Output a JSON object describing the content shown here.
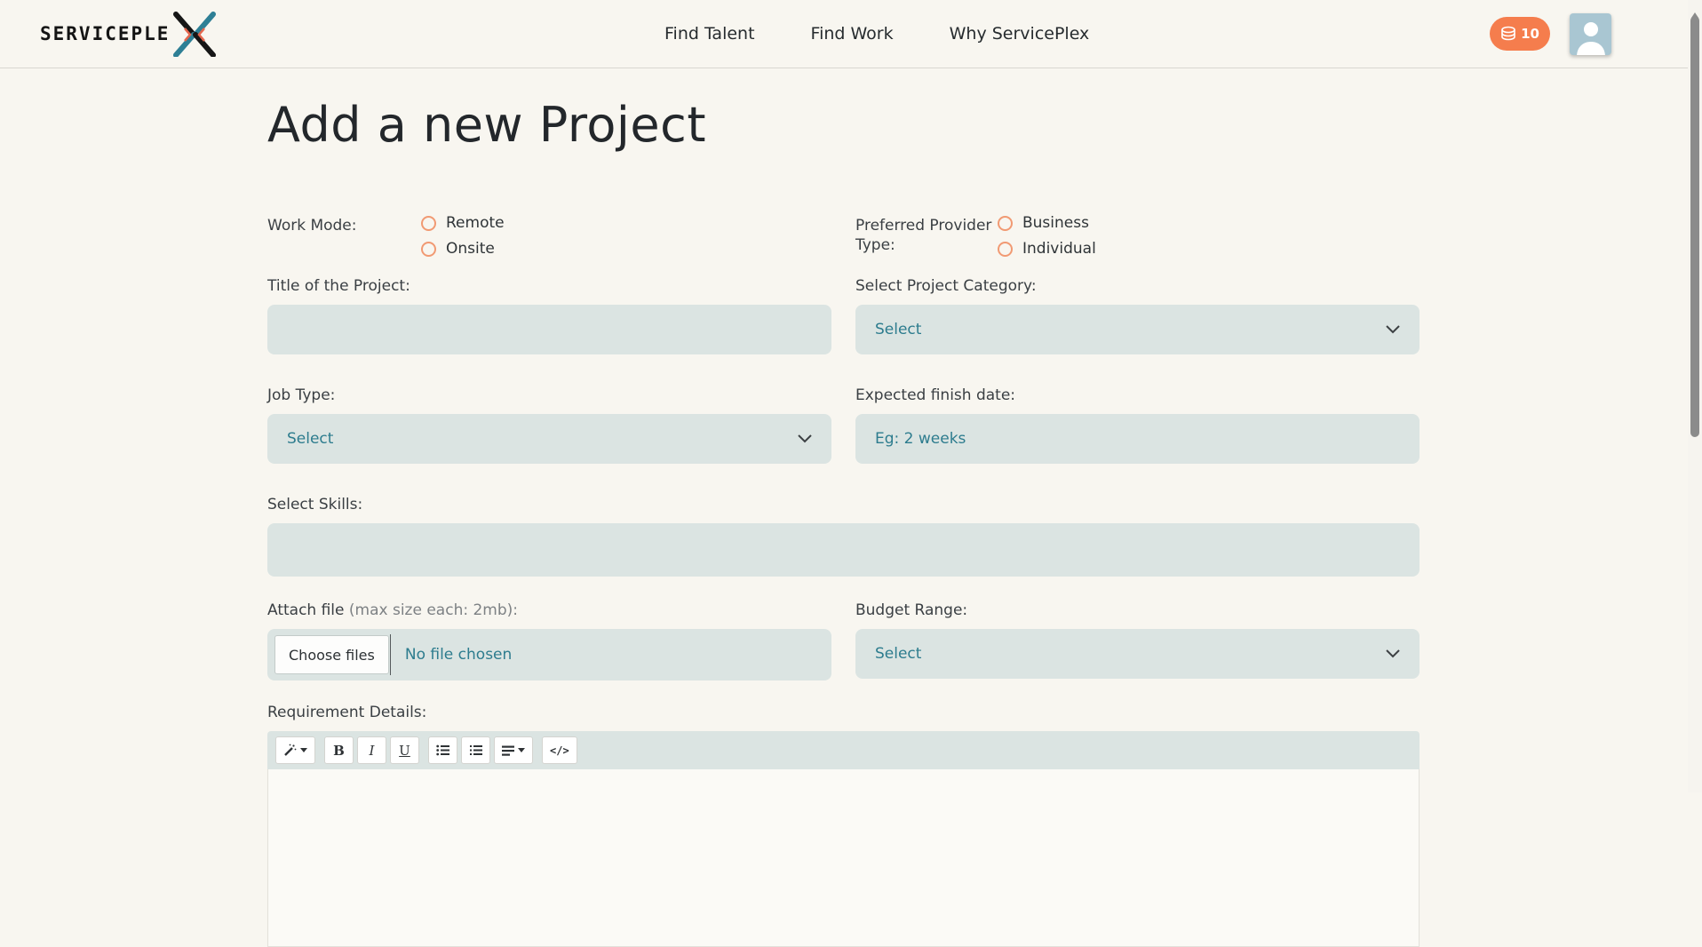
{
  "colors": {
    "accent_orange": "#f57d4d",
    "radio_orange": "#f19a73",
    "teal_text": "#2d7c8e",
    "field_background": "#dbe4e2",
    "avatar_background": "#a9c6d2",
    "logo_teal": "#2e7f95",
    "logo_orange": "#e4664d",
    "page_background": "#f8f6f0"
  },
  "header": {
    "logo_text": "SERVICEPLE",
    "logo_icon": "x-mark-logo-icon",
    "nav": [
      {
        "label": "Find Talent"
      },
      {
        "label": "Find Work"
      },
      {
        "label": "Why ServicePlex"
      }
    ],
    "credits": {
      "icon": "coins-icon",
      "count": "10"
    },
    "avatar_icon": "user-icon"
  },
  "page": {
    "title": "Add a new Project"
  },
  "form": {
    "work_mode": {
      "label": "Work Mode:",
      "options": [
        {
          "label": "Remote"
        },
        {
          "label": "Onsite"
        }
      ]
    },
    "provider_type": {
      "label": "Preferred Provider Type:",
      "options": [
        {
          "label": "Business"
        },
        {
          "label": "Individual"
        }
      ]
    },
    "project_title": {
      "label": "Title of the Project:",
      "value": "",
      "placeholder": ""
    },
    "category": {
      "label": "Select Project Category:",
      "value": "Select"
    },
    "job_type": {
      "label": "Job Type:",
      "value": "Select"
    },
    "finish_date": {
      "label": "Expected finish date:",
      "value": "",
      "placeholder": "Eg: 2 weeks"
    },
    "skills": {
      "label": "Select Skills:",
      "value": "",
      "placeholder": ""
    },
    "attach": {
      "label": "Attach file",
      "note": "(max size each: 2mb):",
      "button_label": "Choose files",
      "status": "No file chosen"
    },
    "budget": {
      "label": "Budget Range:",
      "value": "Select"
    },
    "details": {
      "label": "Requirement Details:",
      "toolbar": {
        "buttons": [
          "magic-wand",
          "bold",
          "italic",
          "underline",
          "unordered-list",
          "ordered-list",
          "paragraph-align",
          "code-view"
        ],
        "bold_glyph": "B",
        "italic_glyph": "I",
        "underline_glyph": "U",
        "code_glyph": "</>"
      },
      "content": ""
    }
  }
}
